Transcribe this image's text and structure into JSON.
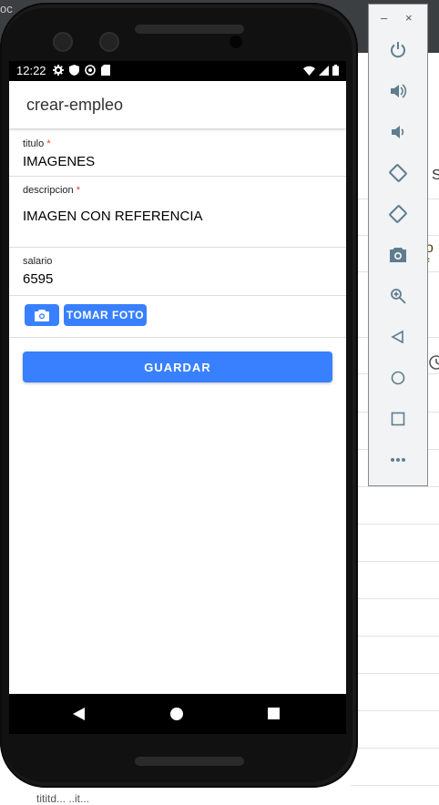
{
  "background_window": {
    "top_fragment": "oc",
    "side_text_1": "S",
    "side_text_2": "o f",
    "bottom_text": "tititd...  ..it..."
  },
  "status_bar": {
    "time": "12:22"
  },
  "app_bar": {
    "title": "crear-empleo"
  },
  "form": {
    "titulo": {
      "label": "titulo",
      "required_mark": "*",
      "value": "IMAGENES"
    },
    "descripcion": {
      "label": "descripcion",
      "required_mark": "*",
      "value": "IMAGEN CON REFERENCIA"
    },
    "salario": {
      "label": "salario",
      "value": "6595"
    },
    "camera_button_icon": "camera-icon",
    "photo_button_label": "TOMAR FOTO",
    "save_button_label": "GUARDAR"
  },
  "emulator_panel": {
    "minimize": "–",
    "close": "×",
    "buttons": [
      "power-icon",
      "volume-up-icon",
      "volume-down-icon",
      "rotate-left-icon",
      "rotate-right-icon",
      "screenshot-icon",
      "zoom-icon",
      "back-icon",
      "home-icon",
      "overview-icon",
      "more-icon"
    ]
  },
  "colors": {
    "primary": "#3880ff",
    "required": "#e53935",
    "panel_icon": "#5f7d8e"
  }
}
